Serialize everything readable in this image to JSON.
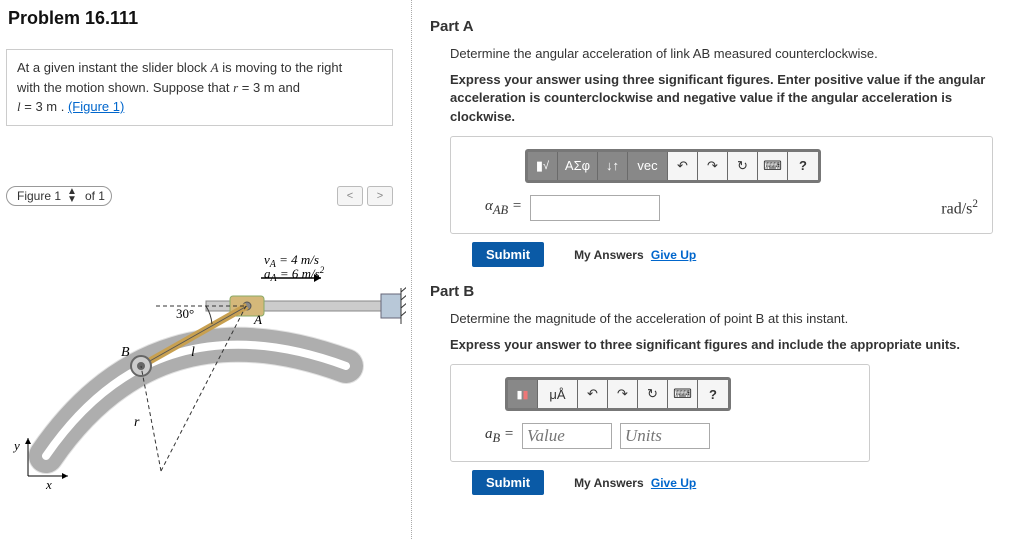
{
  "problem_title": "Problem 16.111",
  "prompt": {
    "l1a": "At a given instant the slider block ",
    "l1b": " is moving to the right",
    "l2": "with the motion shown. Suppose that ",
    "r_eq": "r",
    "r_val": " = 3  m",
    "and": " and",
    "l_eq": "l",
    "l_val": " = 3  m",
    "dot": " . ",
    "fig_link": "(Figure 1)"
  },
  "figure": {
    "selector_label": "Figure 1",
    "of_label": "of 1",
    "prev": "<",
    "next": ">",
    "angle": "30°",
    "va": "v",
    "va_sub": "A",
    "va_eq": " = 4 m/s",
    "aa": "a",
    "aa_sub": "A",
    "aa_eq": " = 6 m/s",
    "aa_sup": "2",
    "lbl_B": "B",
    "lbl_A": "A",
    "lbl_l": "l",
    "lbl_r": "r",
    "lbl_x": "x",
    "lbl_y": "y"
  },
  "partA": {
    "title": "Part A",
    "text": "Determine the angular acceleration of link AB measured counterclockwise.",
    "bold": "Express your answer using three significant figures. Enter positive value if the angular acceleration is counterclockwise and negative value if the angular acceleration is clockwise.",
    "var": "α",
    "var_sub": "AB",
    "eq": " =",
    "units_html": "rad/s",
    "toolbar": {
      "t1": "√",
      "t2": "ΑΣφ",
      "t3": "↓↑",
      "t4": "vec",
      "t5": "↶",
      "t6": "↷",
      "t7": "↻",
      "t8": "⌨",
      "t9": "?"
    }
  },
  "partB": {
    "title": "Part B",
    "text": "Determine the magnitude of the acceleration of point B at this instant.",
    "bold": "Express your answer to three significant figures and include the appropriate units.",
    "var": "a",
    "var_sub": "B",
    "eq": " =",
    "value_ph": "Value",
    "units_ph": "Units",
    "toolbar": {
      "t1": "□",
      "t2": "μÅ",
      "t3": "↶",
      "t4": "↷",
      "t5": "↻",
      "t6": "⌨",
      "t7": "?"
    }
  },
  "common": {
    "submit": "Submit",
    "my_answers": "My Answers",
    "give_up": "Give Up"
  }
}
